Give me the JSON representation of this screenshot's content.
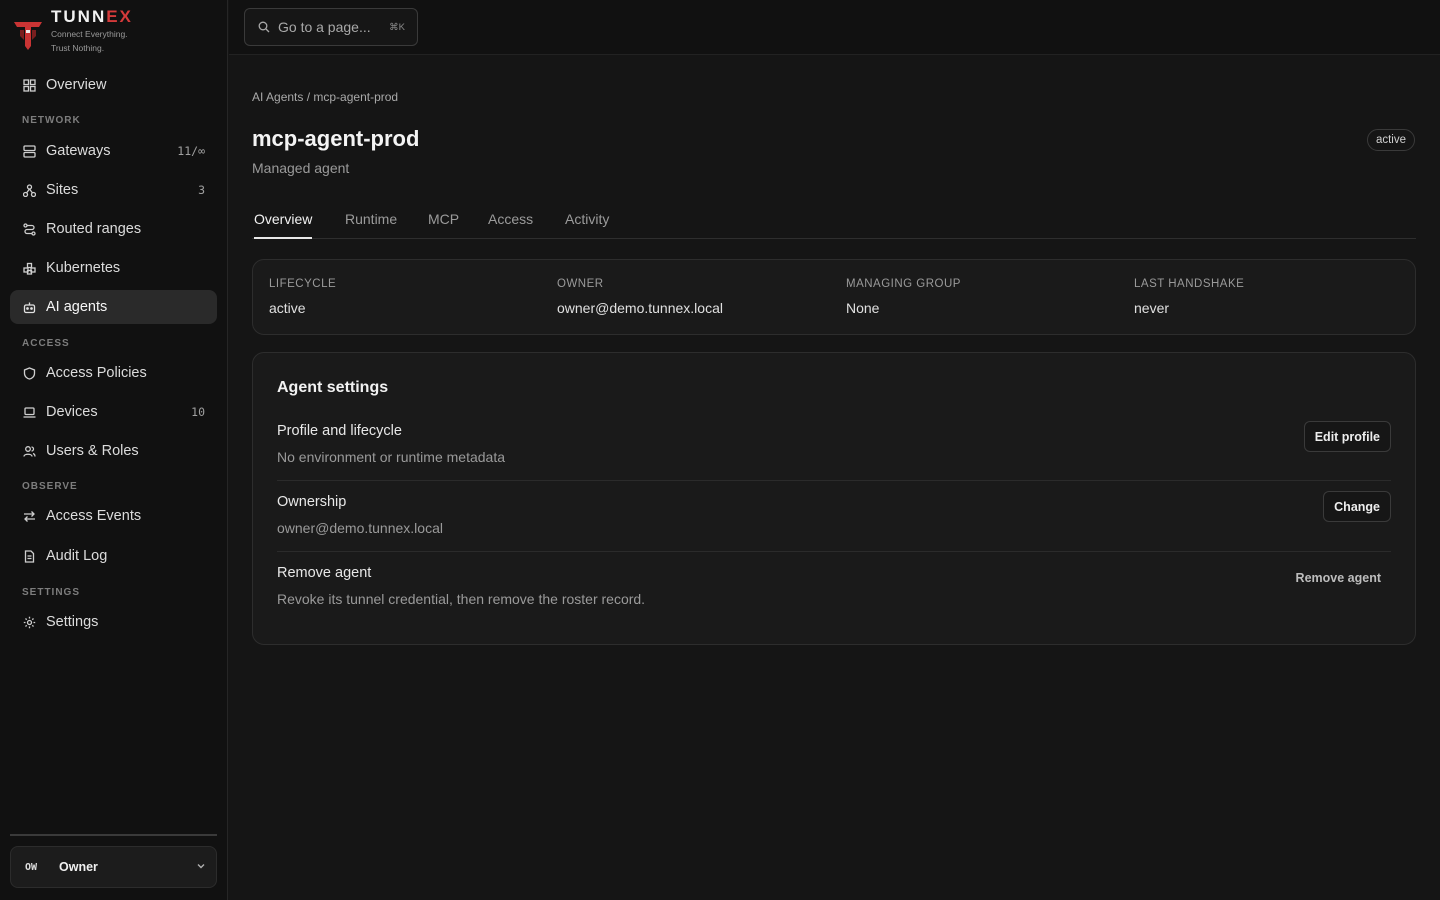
{
  "brand": {
    "name_main": "TUNN",
    "name_accent": "EX",
    "tagline_line1": "Connect Everything.",
    "tagline_line2": "Trust Nothing.",
    "accent_color": "#d43a3a"
  },
  "sidebar": {
    "overview": {
      "label": "Overview",
      "icon": "grid-icon"
    },
    "sections": {
      "network": "NETWORK",
      "access": "ACCESS",
      "observe": "OBSERVE",
      "settings": "SETTINGS"
    },
    "items": {
      "gateways": {
        "label": "Gateways",
        "count": "11/∞",
        "icon": "server-icon"
      },
      "sites": {
        "label": "Sites",
        "count": "3",
        "icon": "sites-icon"
      },
      "routed_ranges": {
        "label": "Routed ranges",
        "icon": "route-icon"
      },
      "kubernetes": {
        "label": "Kubernetes",
        "icon": "kubernetes-icon"
      },
      "ai_agents": {
        "label": "AI agents",
        "icon": "bot-icon"
      },
      "access_policies": {
        "label": "Access Policies",
        "icon": "shield-icon"
      },
      "devices": {
        "label": "Devices",
        "count": "10",
        "icon": "laptop-icon"
      },
      "users_roles": {
        "label": "Users & Roles",
        "icon": "users-icon"
      },
      "access_events": {
        "label": "Access Events",
        "icon": "arrows-icon"
      },
      "audit_log": {
        "label": "Audit Log",
        "icon": "document-icon"
      },
      "settings": {
        "label": "Settings",
        "icon": "gear-icon"
      }
    },
    "active_item": "ai_agents",
    "user": {
      "initials": "OW",
      "name": "Owner"
    }
  },
  "search": {
    "placeholder": "Go to a page...",
    "shortcut": "⌘K"
  },
  "breadcrumb": {
    "parent": "AI Agents",
    "separator": " / ",
    "current": "mcp-agent-prod"
  },
  "page": {
    "title": "mcp-agent-prod",
    "subtitle": "Managed agent",
    "status": "active"
  },
  "tabs": [
    "Overview",
    "Runtime",
    "MCP",
    "Access",
    "Activity"
  ],
  "active_tab": "Overview",
  "stats": [
    {
      "label": "LIFECYCLE",
      "value": "active"
    },
    {
      "label": "OWNER",
      "value": "owner@demo.tunnex.local"
    },
    {
      "label": "MANAGING GROUP",
      "value": "None"
    },
    {
      "label": "LAST HANDSHAKE",
      "value": "never"
    }
  ],
  "agent_settings": {
    "title": "Agent settings",
    "rows": [
      {
        "title": "Profile and lifecycle",
        "description": "No environment or runtime metadata",
        "action": "Edit profile"
      },
      {
        "title": "Ownership",
        "description": "owner@demo.tunnex.local",
        "action": "Change"
      },
      {
        "title": "Remove agent",
        "description": "Revoke its tunnel credential, then remove the roster record.",
        "action": "Remove agent"
      }
    ]
  }
}
